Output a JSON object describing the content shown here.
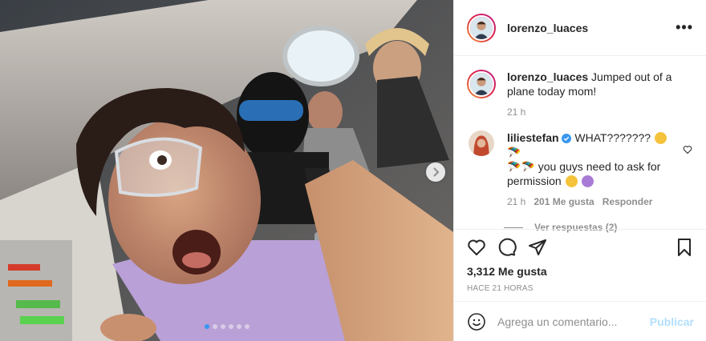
{
  "post": {
    "author": "lorenzo_luaces",
    "more_icon": "more-horizontal-icon",
    "carousel": {
      "slides": 6,
      "active_index": 0,
      "next_icon": "chevron-right-icon"
    },
    "caption": {
      "username": "lorenzo_luaces",
      "text": "Jumped out of a plane today mom!",
      "time": "21 h"
    },
    "comment": {
      "username": "liliestefan",
      "verified_icon": "verified-badge-icon",
      "text_part1": "WHAT???????",
      "text_part2": "you guys need to ask for permission",
      "time": "21 h",
      "likes": "201 Me gusta",
      "reply_label": "Responder",
      "view_replies": "Ver respuestas (2)",
      "like_icon": "heart-icon"
    },
    "actions": {
      "icons": [
        "heart-icon",
        "comment-icon",
        "share-icon",
        "bookmark-icon"
      ],
      "likes": "3,312 Me gusta",
      "posted": "HACE 21 HORAS"
    },
    "add_comment": {
      "emoji_icon": "emoji-icon",
      "placeholder": "Agrega un comentario...",
      "publish": "Publicar"
    },
    "colors": {
      "link_disabled": "#b2dffc",
      "accent": "#3897f0",
      "text": "#262626",
      "muted": "#8e8e8e"
    }
  }
}
